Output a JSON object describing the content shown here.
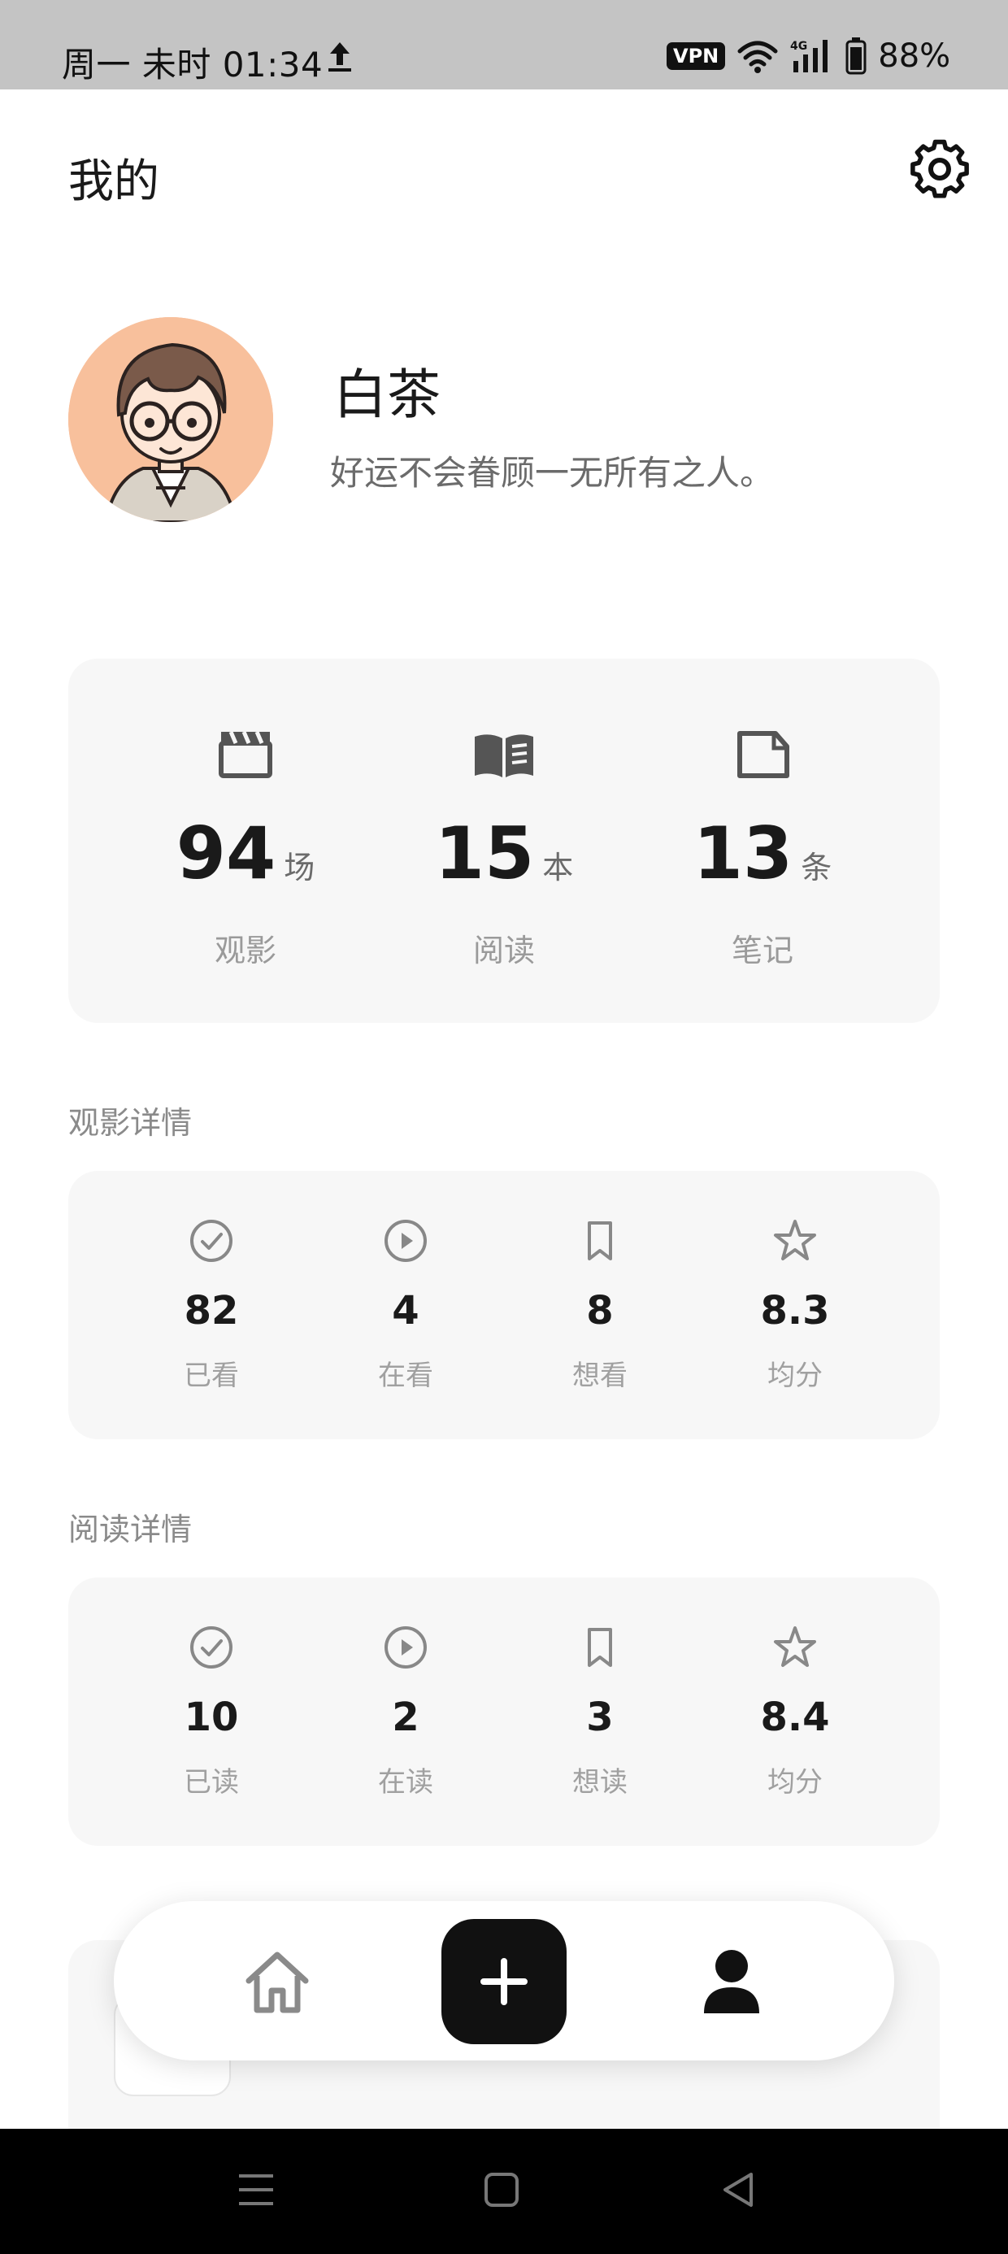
{
  "status_bar": {
    "time": "周一 未时 01:34",
    "vpn": "VPN",
    "network": "4G",
    "battery": "88%",
    "icons": [
      "upload-icon",
      "vpn-badge",
      "wifi-icon",
      "signal-icon",
      "battery-icon"
    ]
  },
  "header": {
    "title": "我的",
    "settings_icon": "gear-icon"
  },
  "profile": {
    "name": "白茶",
    "motto": "好运不会眷顾一无所有之人。"
  },
  "summary": {
    "items": [
      {
        "icon": "clapperboard-icon",
        "value": "94",
        "unit": "场",
        "label": "观影"
      },
      {
        "icon": "open-book-icon",
        "value": "15",
        "unit": "本",
        "label": "阅读"
      },
      {
        "icon": "note-icon",
        "value": "13",
        "unit": "条",
        "label": "笔记"
      }
    ]
  },
  "movie_details": {
    "title": "观影详情",
    "items": [
      {
        "icon": "check-circle-icon",
        "value": "82",
        "label": "已看"
      },
      {
        "icon": "play-circle-icon",
        "value": "4",
        "label": "在看"
      },
      {
        "icon": "bookmark-icon",
        "value": "8",
        "label": "想看"
      },
      {
        "icon": "star-icon",
        "value": "8.3",
        "label": "均分"
      }
    ]
  },
  "reading_details": {
    "title": "阅读详情",
    "items": [
      {
        "icon": "check-circle-icon",
        "value": "10",
        "label": "已读"
      },
      {
        "icon": "play-circle-icon",
        "value": "2",
        "label": "在读"
      },
      {
        "icon": "bookmark-icon",
        "value": "3",
        "label": "想读"
      },
      {
        "icon": "star-icon",
        "value": "8.4",
        "label": "均分"
      }
    ]
  },
  "bottom_nav": {
    "items": [
      "home-icon",
      "plus-icon",
      "person-icon"
    ],
    "active": "person-icon"
  },
  "colors": {
    "card_bg": "#f7f7f7",
    "accent_dark": "#111111",
    "avatar_bg": "#f8c09c"
  }
}
